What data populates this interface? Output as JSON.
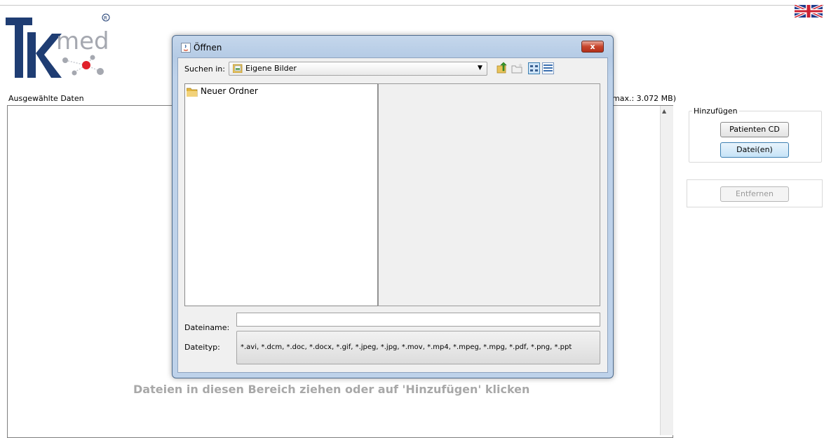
{
  "app": {
    "logo_text": "Tkmed",
    "selected_data_label": "Ausgewählte Daten",
    "size_label": "max.: 3.072 MB)",
    "drop_hint": "Dateien in diesen Bereich ziehen oder auf 'Hinzufügen' klicken",
    "add_group_title": "Hinzufügen",
    "add_cd_button": "Patienten CD",
    "add_files_button": "Datei(en)",
    "remove_button": "Entfernen",
    "language_icon": "uk-flag-icon"
  },
  "dialog": {
    "title": "Öffnen",
    "close_label": "x",
    "look_in_label": "Suchen in:",
    "look_in_value": "Eigene Bilder",
    "files": [
      {
        "name": "Neuer Ordner",
        "icon": "folder-icon"
      }
    ],
    "filename_label": "Dateiname:",
    "filename_value": "",
    "filetype_label": "Dateityp:",
    "filetype_value": "*.avi, *.dcm, *.doc, *.docx, *.gif, *.jpeg, *.jpg, *.mov, *.mp4, *.mpeg, *.mpg, *.pdf, *.png, *.ppt",
    "toolbar_icons": [
      "up-folder-icon",
      "new-folder-icon",
      "list-view-icon",
      "details-view-icon"
    ]
  },
  "colors": {
    "logo_blue": "#1f3d73",
    "logo_red": "#e0202a",
    "logo_gray": "#a5a8b0",
    "drop_hint": "#a8a8a8",
    "dialog_frame": "#bed2ea"
  }
}
